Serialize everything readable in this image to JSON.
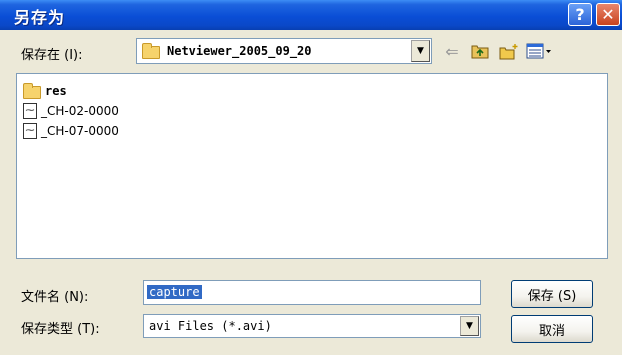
{
  "window": {
    "title": "另存为",
    "help_glyph": "?",
    "close_glyph": "✕"
  },
  "save_in": {
    "label": "保存在 (I):",
    "path": "Netviewer_2005_09_20",
    "dropdown_glyph": "▼"
  },
  "toolbar": {
    "back_glyph": "⇐",
    "up_icon": "up-one-level-icon",
    "new_folder_icon": "new-folder-icon",
    "views_icon": "views-menu-icon"
  },
  "files": [
    {
      "name": "res",
      "type": "folder"
    },
    {
      "name": "_CH-02-0000",
      "type": "file"
    },
    {
      "name": "_CH-07-0000",
      "type": "file"
    }
  ],
  "file_name": {
    "label": "文件名 (N):",
    "value": "capture"
  },
  "file_type": {
    "label": "保存类型 (T):",
    "value": "avi Files (*.avi)",
    "dropdown_glyph": "▼"
  },
  "buttons": {
    "save": "保存 (S)",
    "cancel": "取消"
  },
  "colors": {
    "titlebar": "#0a4ed6",
    "selection": "#316ac5",
    "close": "#c9431f"
  }
}
